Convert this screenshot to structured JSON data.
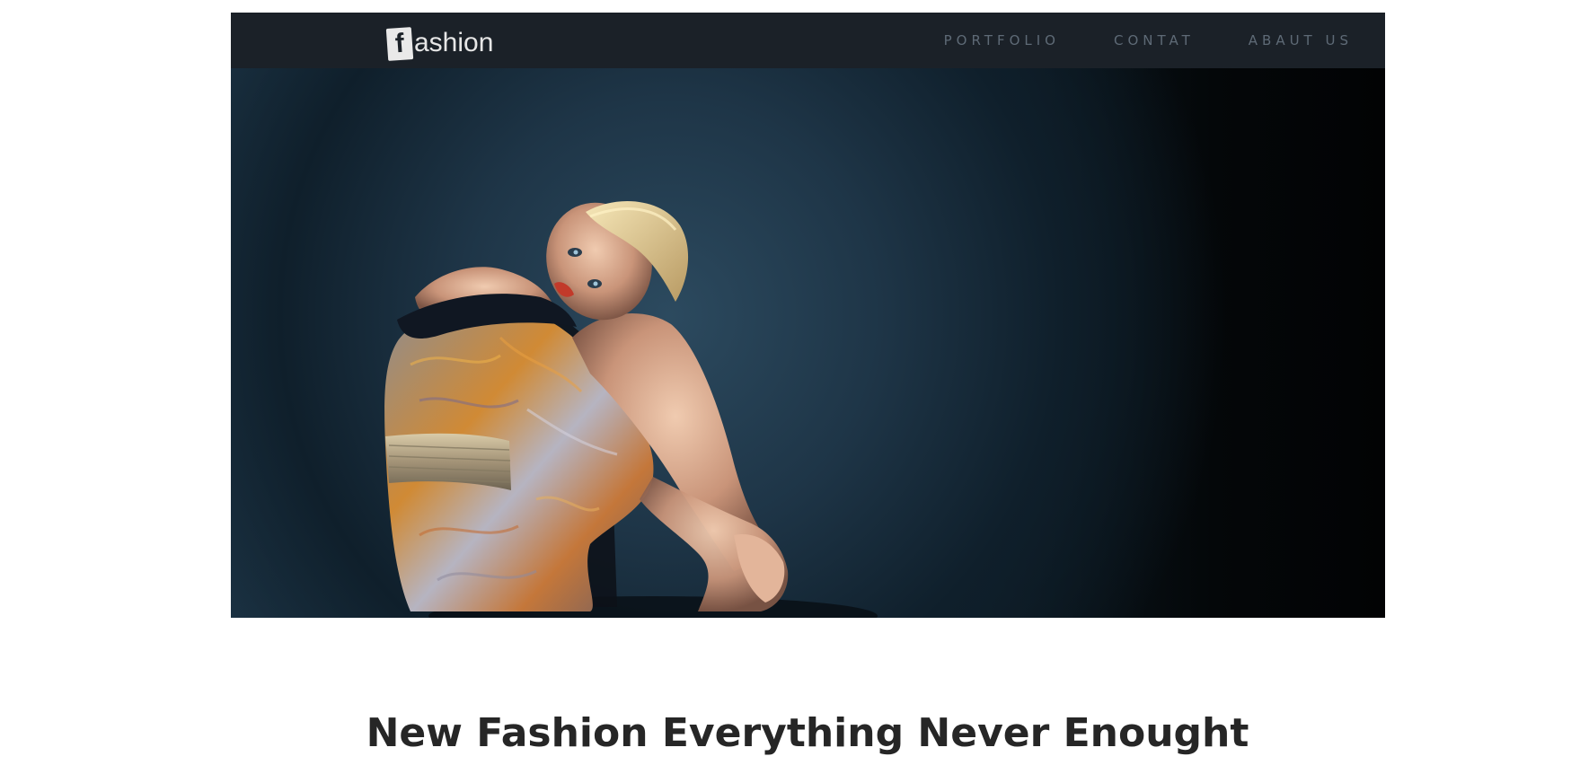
{
  "brand": {
    "logo_letter": "f",
    "logo_text": "ashion"
  },
  "nav": {
    "items": [
      {
        "label": "PORTFOLIO"
      },
      {
        "label": "CONTAT"
      },
      {
        "label": "ABAUT US"
      }
    ]
  },
  "hero": {
    "image": "fashion-model-photo"
  },
  "headline": "New Fashion Everything Never Enought"
}
